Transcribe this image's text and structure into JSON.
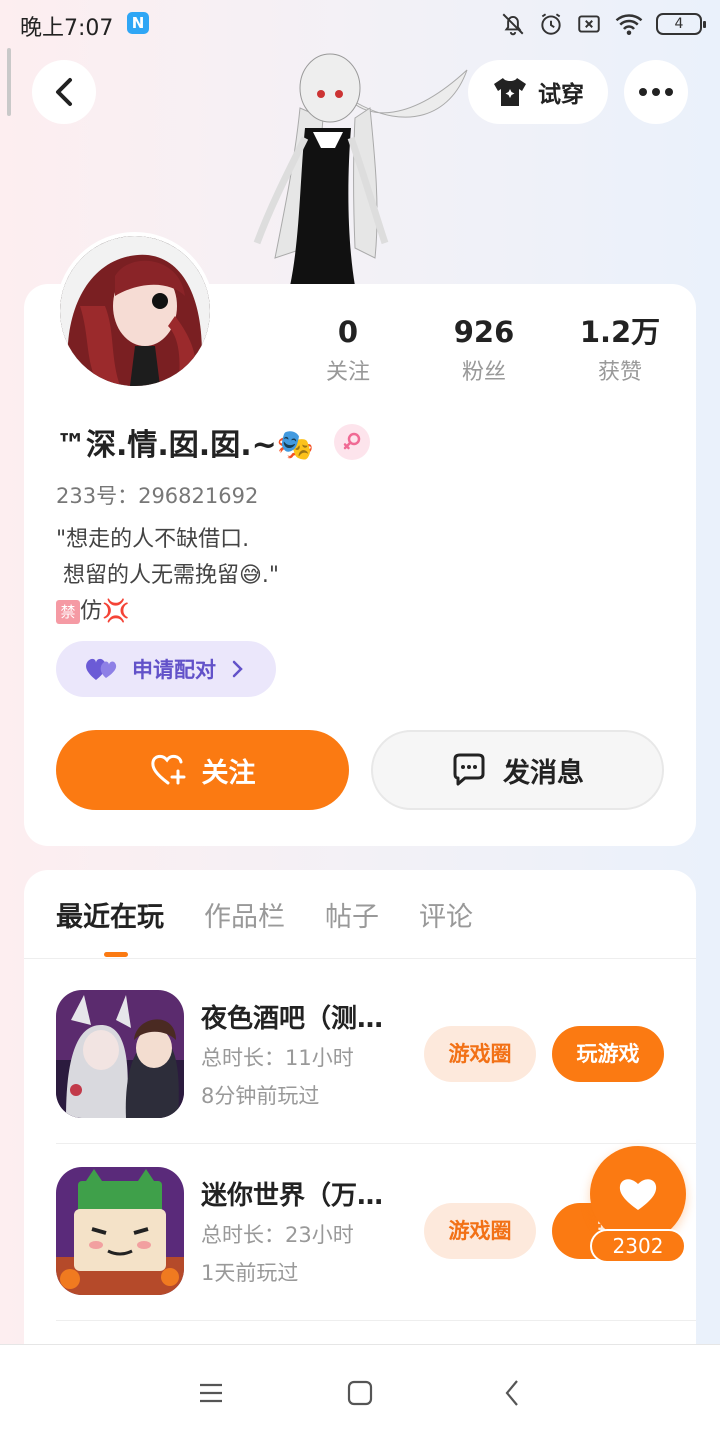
{
  "status_bar": {
    "time": "晚上7:07",
    "badge": "N",
    "battery": "4"
  },
  "header": {
    "try_on_label": "试穿"
  },
  "profile": {
    "stats": [
      {
        "value": "0",
        "label": "关注"
      },
      {
        "value": "926",
        "label": "粉丝"
      },
      {
        "value": "1.2万",
        "label": "获赞"
      }
    ],
    "nickname": "™深.情.囡.囡.~🎭",
    "uid": "233号：296821692",
    "bio": "\"想走的人不缺借口.\n 想留的人无需挽留😅.\"",
    "bio_tag": "禁",
    "bio_tag_suffix": "仿💢",
    "pair_label": "申请配对",
    "follow_label": "关注",
    "message_label": "发消息"
  },
  "tabs": [
    {
      "label": "最近在玩",
      "active": true
    },
    {
      "label": "作品栏",
      "active": false
    },
    {
      "label": "帖子",
      "active": false
    },
    {
      "label": "评论",
      "active": false
    }
  ],
  "games": [
    {
      "title": "夜色酒吧（测…",
      "duration": "总时长：11小时",
      "last_played": "8分钟前玩过",
      "circle_label": "游戏圈",
      "play_label": "玩游戏"
    },
    {
      "title": "迷你世界（万…",
      "duration": "总时长：23小时",
      "last_played": "1天前玩过",
      "circle_label": "游戏圈",
      "play_label": "玩"
    }
  ],
  "like": {
    "count": "2302"
  },
  "colors": {
    "accent": "#fb7a12",
    "pair_bg": "#ebe7fb",
    "pair_text": "#6252c9"
  }
}
